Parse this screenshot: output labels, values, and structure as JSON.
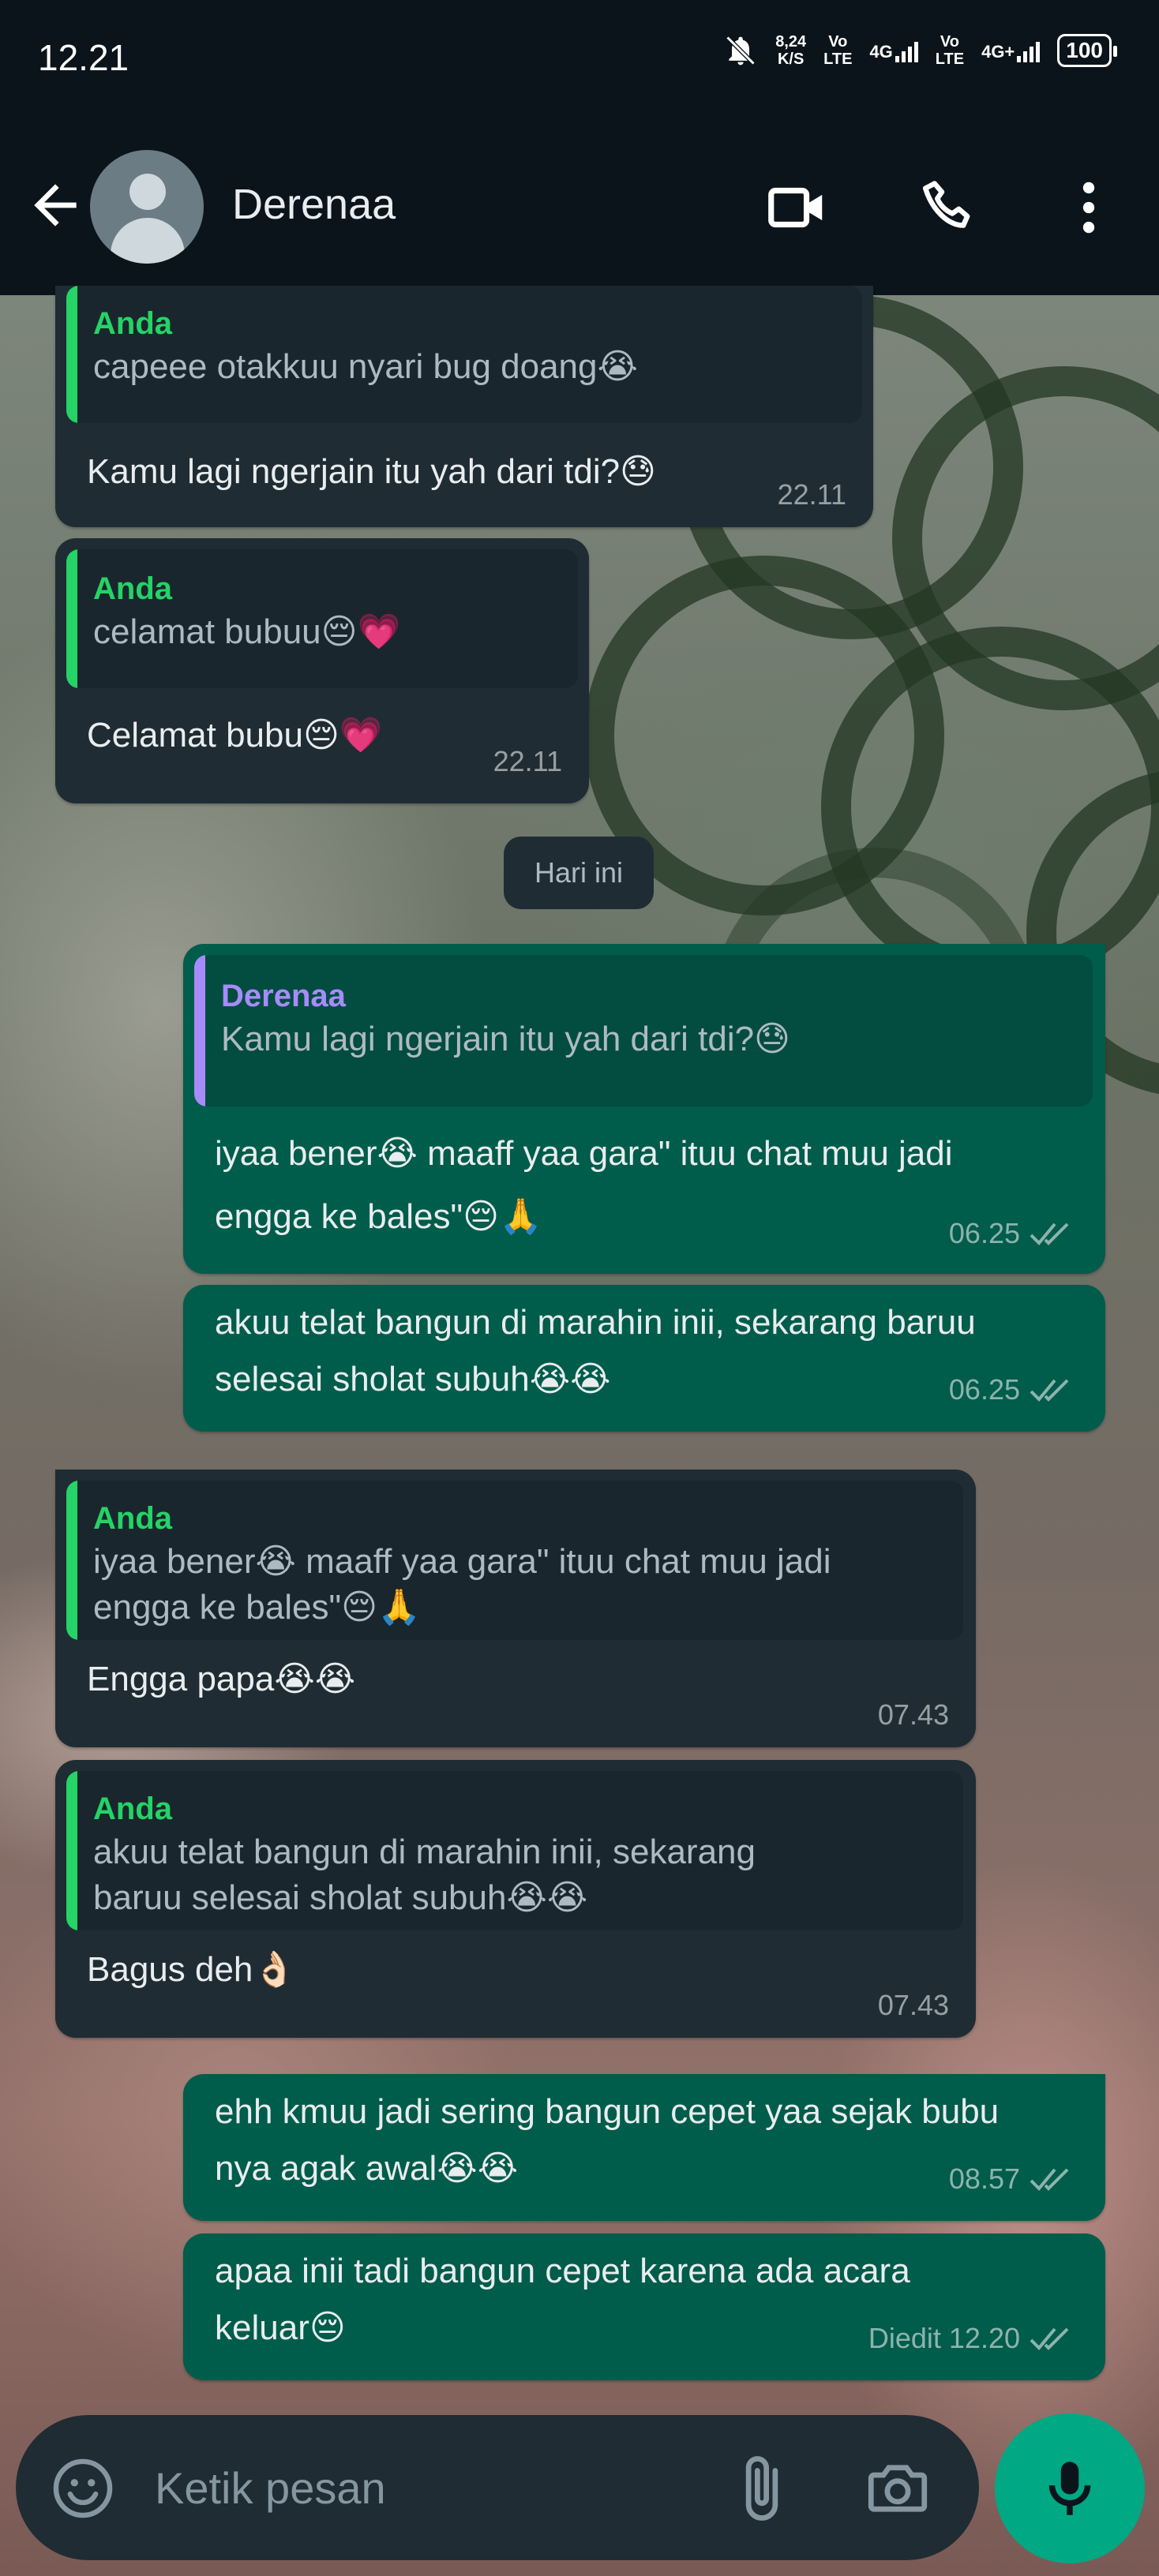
{
  "status_bar": {
    "time": "12.21",
    "net_speed_value": "8,24",
    "net_speed_unit": "K/S",
    "volte1_top": "Vo",
    "volte1_bottom": "LTE",
    "sig1_label": "4G",
    "volte2_top": "Vo",
    "volte2_bottom": "LTE",
    "sig2_label": "4G+",
    "battery": "100",
    "icons": [
      "mute-bell-icon",
      "signal-icon",
      "battery-icon"
    ]
  },
  "header": {
    "contact_name": "Derenaa",
    "icons": [
      "back-arrow-icon",
      "avatar-icon",
      "video-call-icon",
      "voice-call-icon",
      "more-vert-icon"
    ]
  },
  "colors": {
    "background": "#0b141a",
    "incoming_bubble": "#1f2c34",
    "outgoing_bubble": "#005c4b",
    "quote_self_accent": "#25d366",
    "quote_contact_accent": "#a78bfa",
    "accent_green": "#00a884"
  },
  "messages": [
    {
      "direction": "incoming",
      "quote_author": "Anda",
      "quote_text": "capeee otakkuu nyari bug doang😭",
      "text": "Kamu lagi ngerjain itu yah dari tdi?😓",
      "time": "22.11"
    },
    {
      "direction": "incoming",
      "quote_author": "Anda",
      "quote_text": "celamat bubuu😔💗",
      "text": "Celamat bubu😔💗",
      "time": "22.11"
    },
    {
      "direction": "outgoing",
      "quote_author": "Derenaa",
      "quote_text": "Kamu lagi ngerjain itu yah dari tdi?😓",
      "text_line1": "iyaa bener😭 maaff yaa gara\" ituu chat muu jadi",
      "text_line2": "engga ke bales\"😔🙏",
      "time": "06.25"
    },
    {
      "direction": "outgoing",
      "text_line1": "akuu telat bangun di marahin inii, sekarang baruu",
      "text_line2": "selesai sholat subuh😭😭",
      "time": "06.25"
    },
    {
      "direction": "incoming",
      "quote_author": "Anda",
      "quote_line1": "iyaa bener😭 maaff yaa gara\" ituu chat muu jadi",
      "quote_line2": "engga ke bales\"😔🙏",
      "text": "Engga papa😭😭",
      "time": "07.43"
    },
    {
      "direction": "incoming",
      "quote_author": "Anda",
      "quote_line1": "akuu telat bangun di marahin inii, sekarang",
      "quote_line2": "baruu selesai sholat subuh😭😭",
      "text": "Bagus deh👌🏻",
      "time": "07.43"
    },
    {
      "direction": "outgoing",
      "text_line1": "ehh kmuu jadi sering bangun cepet yaa sejak bubu",
      "text_line2": "nya agak awal😭😭",
      "time": "08.57"
    },
    {
      "direction": "outgoing",
      "text_line1": "apaa inii tadi bangun cepet karena ada acara",
      "text_line2": "keluar😔",
      "edited_label": "Diedit",
      "time": "12.20"
    }
  ],
  "date_separator": "Hari ini",
  "composer": {
    "placeholder": "Ketik pesan",
    "icons": [
      "emoji-icon",
      "attach-icon",
      "camera-icon",
      "mic-icon"
    ]
  }
}
